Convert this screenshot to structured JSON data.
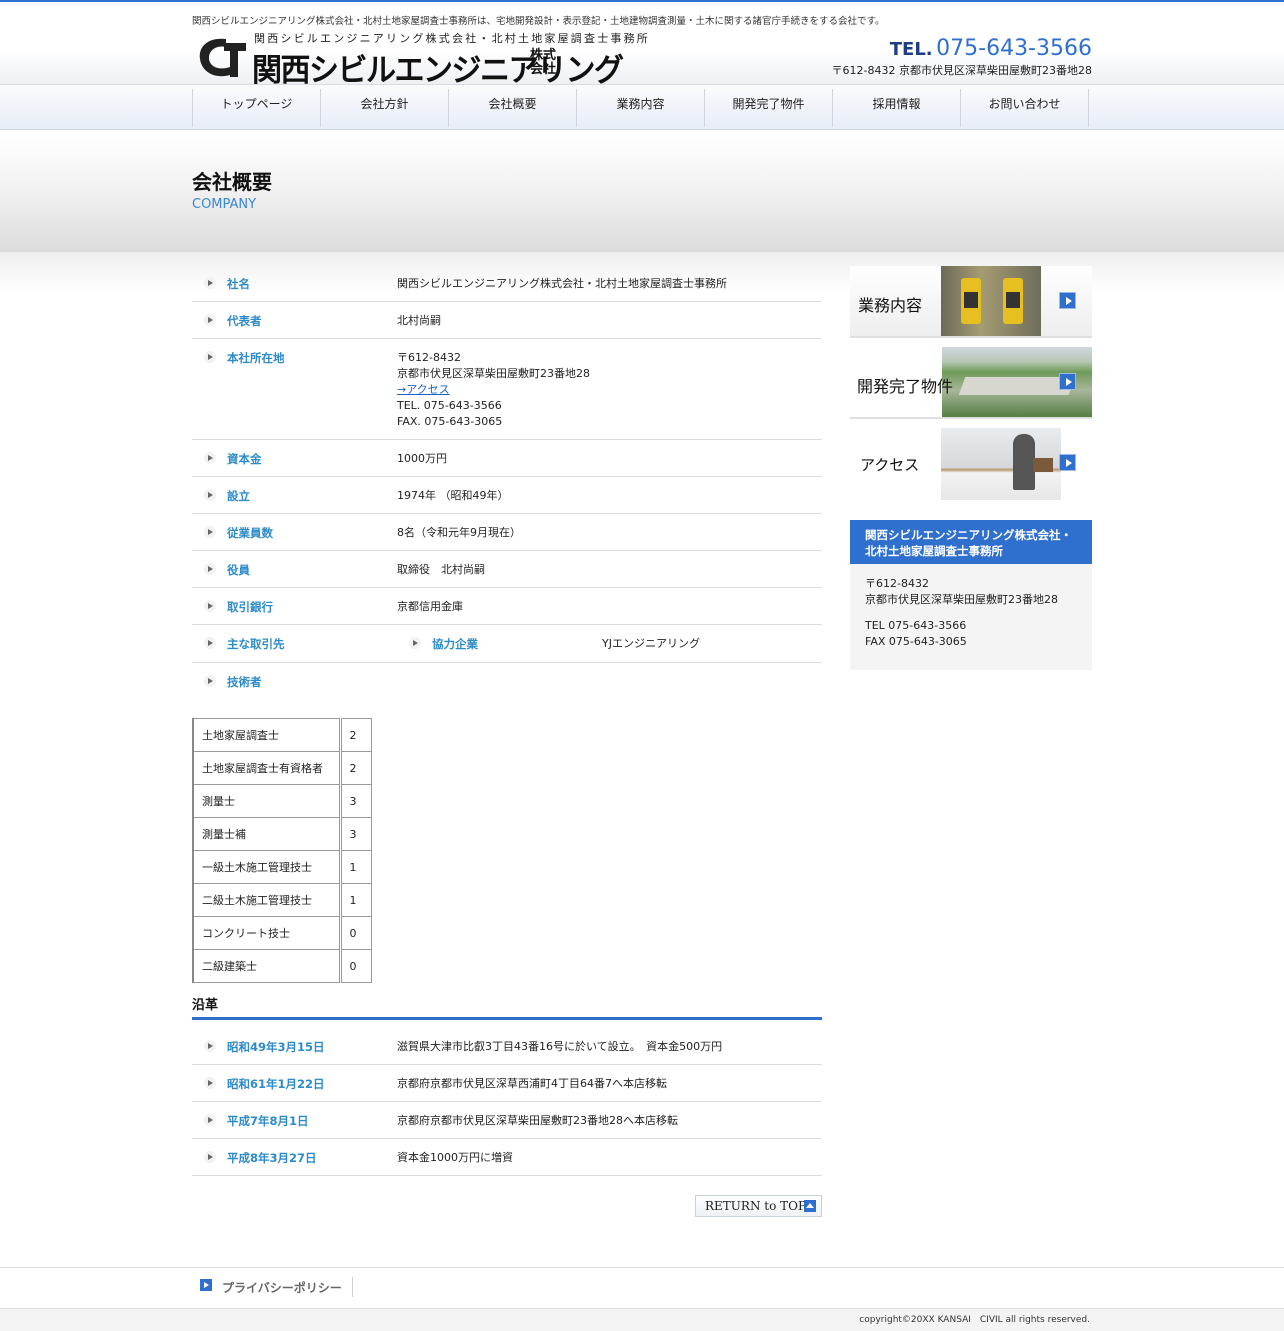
{
  "header": {
    "tagline": "関西シビルエンジニアリング株式会社・北村土地家屋調査士事務所は、宅地開発設計・表示登記・土地建物調査測量・土木に関する諸官庁手続きをする会社です。",
    "logo_sub": "関西シビルエンジニアリング株式会社・北村土地家屋調査士事務所",
    "logo_main": "関西シビルエンジニアリング",
    "logo_kk": "株式会社",
    "tel_label": "TEL.",
    "tel_number": "075-643-3566",
    "address": "〒612-8432 京都市伏見区深草柴田屋敷町23番地28"
  },
  "nav": [
    "トップページ",
    "会社方針",
    "会社概要",
    "業務内容",
    "開発完了物件",
    "採用情報",
    "お問い合わせ"
  ],
  "page": {
    "title": "会社概要",
    "subtitle": "COMPANY"
  },
  "company": {
    "name_label": "社名",
    "name": "関西シビルエンジニアリング株式会社・北村土地家屋調査士事務所",
    "rep_label": "代表者",
    "rep": "北村尚嗣",
    "hq_label": "本社所在地",
    "hq_zip": "〒612-8432",
    "hq_addr": "京都市伏見区深草柴田屋敷町23番地28",
    "hq_access": "→アクセス",
    "hq_tel": "TEL. 075-643-3566",
    "hq_fax": "FAX. 075-643-3065",
    "capital_label": "資本金",
    "capital": "1000万円",
    "founded_label": "設立",
    "founded": "1974年 （昭和49年）",
    "employees_label": "従業員数",
    "employees": "8名（令和元年9月現在）",
    "officers_label": "役員",
    "officers": "取締役　北村尚嗣",
    "bank_label": "取引銀行",
    "bank": "京都信用金庫",
    "clients_label": "主な取引先",
    "partner_label": "協力企業",
    "partner": "YJエンジニアリング",
    "engineers_label": "技術者"
  },
  "engineers": [
    {
      "title": "土地家屋調査士",
      "count": "2"
    },
    {
      "title": "土地家屋調査士有資格者",
      "count": "2"
    },
    {
      "title": "測量士",
      "count": "3"
    },
    {
      "title": "測量士補",
      "count": "3"
    },
    {
      "title": "一級土木施工管理技士",
      "count": "1"
    },
    {
      "title": "二級土木施工管理技士",
      "count": "1"
    },
    {
      "title": "コンクリート技士",
      "count": "0"
    },
    {
      "title": "二級建築士",
      "count": "0"
    }
  ],
  "history": {
    "title": "沿革",
    "items": [
      {
        "date": "昭和49年3月15日",
        "text": "滋賀県大津市比叡3丁目43番16号に於いて設立。　資本金500万円"
      },
      {
        "date": "昭和61年1月22日",
        "text": "京都府京都市伏見区深草西浦町4丁目64番7へ本店移転"
      },
      {
        "date": "平成7年8月1日",
        "text": "京都府京都市伏見区深草柴田屋敷町23番地28へ本店移転"
      },
      {
        "date": "平成8年3月27日",
        "text": "資本金1000万円に増資"
      }
    ]
  },
  "return_top": "RETURN to TOP",
  "sidebar": {
    "cards": [
      "業務内容",
      "開発完了物件",
      "アクセス"
    ],
    "info_title": "関西シビルエンジニアリング株式会社・北村土地家屋調査士事務所",
    "info_zip": "〒612-8432",
    "info_addr": "京都市伏見区深草柴田屋敷町23番地28",
    "info_tel": "TEL 075-643-3566",
    "info_fax": "FAX 075-643-3065"
  },
  "footer": {
    "privacy": "プライバシーポリシー",
    "copyright": "copyright©20XX KANSAI　CIVIL all rights reserved."
  },
  "colors": {
    "accent": "#2f6fce",
    "label": "#2e8bc9"
  }
}
